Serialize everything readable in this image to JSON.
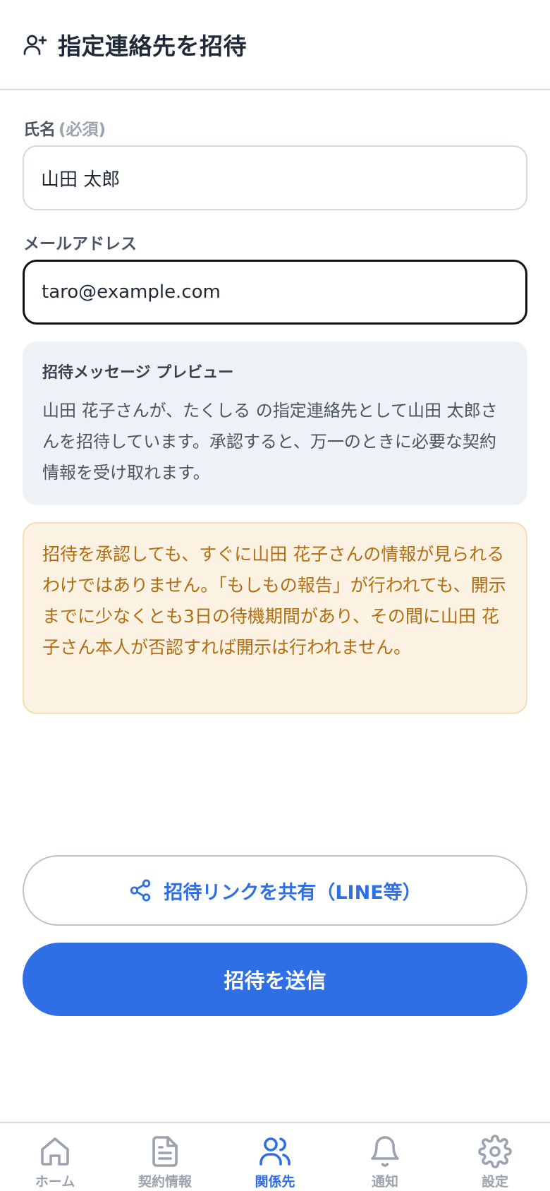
{
  "header": {
    "title": "指定連絡先を招待",
    "icon": "user-plus-icon"
  },
  "form": {
    "name_label": "氏名",
    "name_required": "(必須)",
    "name_value": "山田 太郎",
    "email_label": "メールアドレス",
    "email_value": "taro@example.com"
  },
  "preview": {
    "title": "招待メッセージ プレビュー",
    "body": "山田 花子さんが、たくしる の指定連絡先として山田 太郎さんを招待しています。承認すると、万一のときに必要な契約情報を受け取れます。"
  },
  "warning": {
    "body": "招待を承認しても、すぐに山田 花子さんの情報が見られるわけではありません。「もしもの報告」が行われても、開示までに少なくとも3日の待機期間があり、その間に山田 花子さん本人が否認すれば開示は行われません。"
  },
  "buttons": {
    "share_label": "招待リンクを共有（LINE等）",
    "send_label": "招待を送信"
  },
  "nav": {
    "items": [
      {
        "label": "ホーム",
        "icon": "home-icon"
      },
      {
        "label": "契約情報",
        "icon": "document-icon"
      },
      {
        "label": "関係先",
        "icon": "users-icon"
      },
      {
        "label": "通知",
        "icon": "bell-icon"
      },
      {
        "label": "設定",
        "icon": "gear-icon"
      }
    ],
    "active_index": 2
  },
  "colors": {
    "accent": "#2f6fe6",
    "warning_text": "#b16d10",
    "warning_bg": "#fcf2e3",
    "preview_bg": "#eef2f6"
  }
}
